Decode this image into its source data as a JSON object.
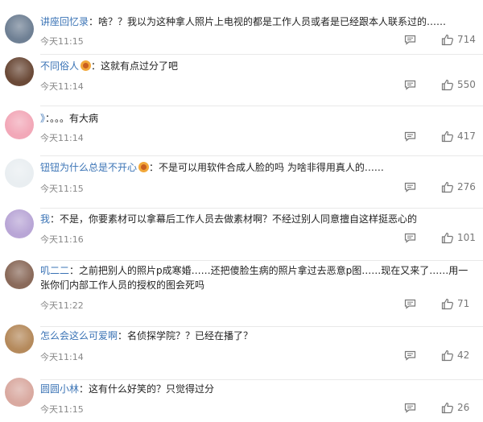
{
  "comments": [
    {
      "username": "讲座回忆录",
      "text": "啥？？我以为这种拿人照片上电视的都是工作人员或者是已经跟本人联系过的……",
      "time": "今天11:15",
      "likes": "714",
      "has_badge": false,
      "avatar_color": "#6f8094"
    },
    {
      "username": "不同俗人",
      "text": "这就有点过分了吧",
      "time": "今天11:14",
      "likes": "550",
      "has_badge": true,
      "avatar_color": "#6b4a38"
    },
    {
      "username": "》",
      "text": "。。。有大病",
      "time": "今天11:14",
      "likes": "417",
      "has_badge": false,
      "avatar_color": "#f2a8b8"
    },
    {
      "username": "钮钮为什么总是不开心",
      "text": "不是可以用软件合成人脸的吗 为啥非得用真人的……",
      "time": "今天11:15",
      "likes": "276",
      "has_badge": true,
      "avatar_color": "#e9eef1"
    },
    {
      "username": "我",
      "text": "不是，你要素材可以拿幕后工作人员去做素材啊？不经过别人同意擅自这样挺恶心的",
      "time": "今天11:16",
      "likes": "101",
      "has_badge": false,
      "avatar_color": "#b9a6d6"
    },
    {
      "username": "叽二二",
      "text": "之前把别人的照片p成寒婚……还把傻脸生病的照片拿过去恶意p图……现在又来了……用一张你们内部工作人员的授权的图会死吗",
      "time": "今天11:22",
      "likes": "71",
      "has_badge": false,
      "avatar_color": "#8a6a5a"
    },
    {
      "username": "怎么会这么可爱啊",
      "text": "名侦探学院？？已经在播了？",
      "time": "今天11:14",
      "likes": "42",
      "has_badge": false,
      "avatar_color": "#b58a5c"
    },
    {
      "username": "圆圆小林",
      "text": "这有什么好笑的？只觉得过分",
      "time": "今天11:15",
      "likes": "26",
      "has_badge": false,
      "avatar_color": "#d9a9a0"
    }
  ],
  "colors": {
    "username": "#3a73b5",
    "text": "#222222",
    "meta": "#888888"
  },
  "icons": {
    "reply": "comment-bubble-icon",
    "like": "thumbs-up-icon",
    "badge": "vip-badge-icon"
  }
}
